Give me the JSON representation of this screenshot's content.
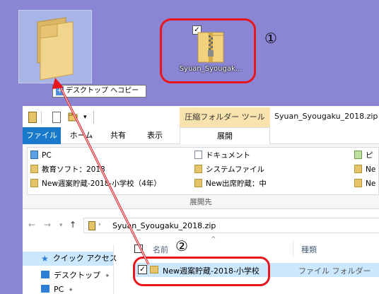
{
  "desktop": {
    "tooltip_plus": "+",
    "tooltip_text": "デスクトップ へコピー",
    "zip_label": "Syuan_Syougak...",
    "zip_checked": "✓",
    "annotation_1": "①"
  },
  "window": {
    "title": "Syuan_Syougaku_2018.zip",
    "context_tab": "圧縮フォルダー ツール",
    "quick_access_dropdown": "▾"
  },
  "tabs": {
    "file": "ファイル",
    "home": "ホーム",
    "share": "共有",
    "view": "表示",
    "extract": "展開"
  },
  "ribbon": {
    "destinations": [
      {
        "label": "PC",
        "icon": "pc-icon"
      },
      {
        "label": "ドキュメント",
        "icon": "documents-icon"
      },
      {
        "label": "ピ",
        "icon": "pictures-icon"
      },
      {
        "label": "教育ソフト：2018",
        "icon": "folder-icon"
      },
      {
        "label": "システムファイル",
        "icon": "folder-icon"
      },
      {
        "label": "Ne",
        "icon": "folder-icon"
      },
      {
        "label": "New週案貯蔵-2018-小学校（4年）",
        "icon": "folder-icon"
      },
      {
        "label": "New出席貯蔵：中",
        "icon": "folder-icon"
      },
      {
        "label": "Ne",
        "icon": "folder-icon"
      }
    ],
    "group_label": "展開先"
  },
  "address": {
    "back": "←",
    "forward": "→",
    "dropdown": "▾",
    "up": "↑",
    "sep": "›",
    "path": "Syuan_Syougaku_2018.zip"
  },
  "navpane": {
    "items": [
      {
        "label": "クイック アクセス",
        "icon": "star-icon"
      },
      {
        "label": "デスクトップ",
        "icon": "desktop-icon",
        "pin": "✦"
      },
      {
        "label": "PC",
        "icon": "pc-icon",
        "pin": "✦"
      }
    ]
  },
  "columns": {
    "name": "名前",
    "sort_indicator": "^",
    "type": "種類"
  },
  "annotation_2": "②",
  "files": [
    {
      "name": "New週案貯蔵-2018-小学校",
      "type": "ファイル フォルダー",
      "checked": "✓"
    }
  ],
  "colors": {
    "desktop_bg": "#8a86d4",
    "annotation_red": "#e8161c",
    "file_tab": "#1979ca",
    "context_tab": "#f8e2ae",
    "selection": "#cce8ff"
  }
}
